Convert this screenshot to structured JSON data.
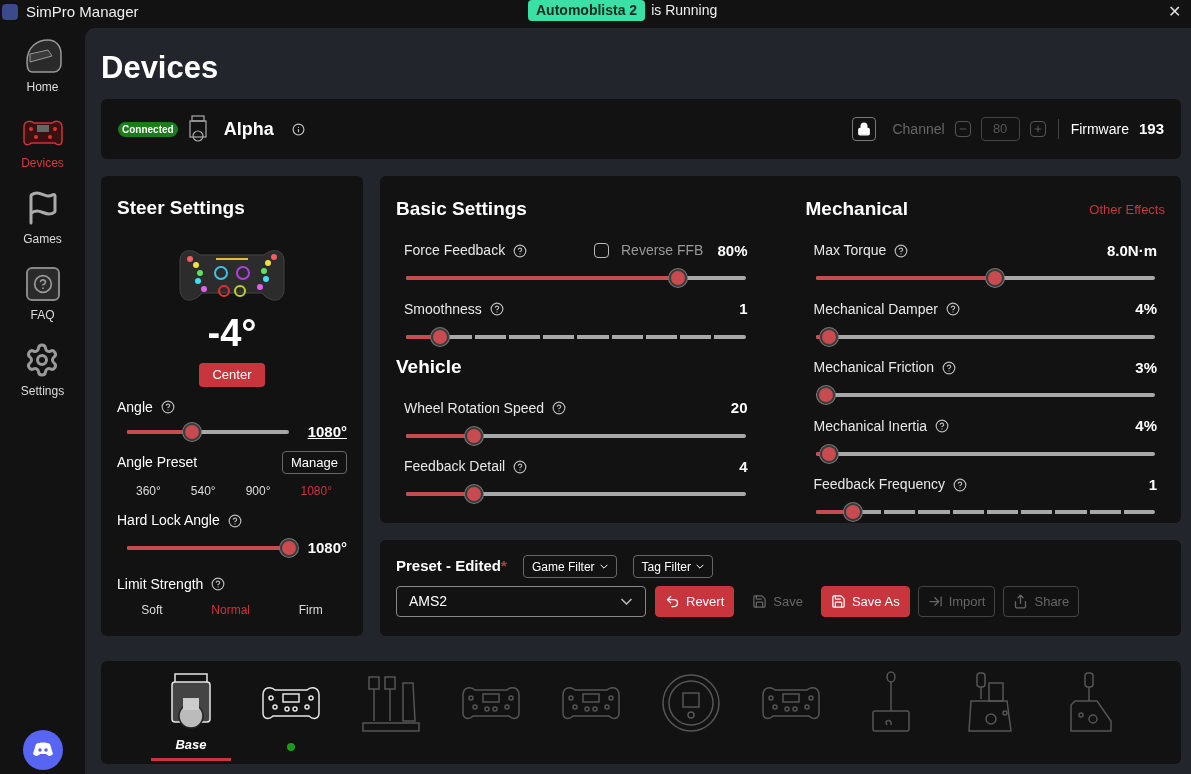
{
  "title_bar": {
    "app_name": "SimPro Manager",
    "game": "Automoblista 2",
    "status": "is Running",
    "close": "✕"
  },
  "sidebar": {
    "items": [
      {
        "kind": "home",
        "label": "Home",
        "selected": false
      },
      {
        "kind": "devices",
        "label": "Devices",
        "selected": true
      },
      {
        "kind": "games",
        "label": "Games",
        "selected": false
      },
      {
        "kind": "faq",
        "label": "FAQ",
        "selected": false
      },
      {
        "kind": "settings",
        "label": "Settings",
        "selected": false
      }
    ]
  },
  "page_title": "Devices",
  "device_bar": {
    "status": "Connected",
    "name": "Alpha",
    "locked": true,
    "channel_label": "Channel",
    "channel_value": "80",
    "firmware_label": "Firmware",
    "firmware_version": "193"
  },
  "steer": {
    "title": "Steer Settings",
    "angle_reading": "-4°",
    "center_button": "Center",
    "angle": {
      "label": "Angle",
      "level": 0.4,
      "reading": "1080°"
    },
    "preset_label": "Angle Preset",
    "manage_button": "Manage",
    "presets": [
      {
        "label": "360°",
        "selected": false
      },
      {
        "label": "540°",
        "selected": false
      },
      {
        "label": "900°",
        "selected": false
      },
      {
        "label": "1080°",
        "selected": true
      }
    ],
    "hard_lock": {
      "label": "Hard Lock Angle",
      "level": 1,
      "reading": "1080°"
    },
    "limit_label": "Limit Strength",
    "limits": [
      {
        "label": "Soft",
        "selected": false
      },
      {
        "label": "Normal",
        "selected": true
      },
      {
        "label": "Firm",
        "selected": false
      }
    ]
  },
  "basic": {
    "title": "Basic Settings",
    "reverse_ffb": {
      "label": "Reverse FFB",
      "checked": false
    },
    "sliders": [
      {
        "kind": "plain",
        "label": "Force Feedback",
        "level": 0.8,
        "reading": "80%"
      },
      {
        "kind": "stepped",
        "label": "Smoothness",
        "level": 0.1,
        "reading": "1"
      }
    ]
  },
  "vehicle": {
    "title": "Vehicle",
    "sliders": [
      {
        "kind": "plain",
        "label": "Wheel Rotation Speed",
        "level": 0.2,
        "reading": "20"
      },
      {
        "kind": "plain",
        "label": "Feedback Detail",
        "level": 0.2,
        "reading": "4"
      }
    ]
  },
  "mechanical": {
    "title": "Mechanical",
    "link": "Other Effects",
    "sliders": [
      {
        "kind": "plain",
        "label": "Max Torque",
        "level": 0.53,
        "reading": "8.0N·m"
      },
      {
        "kind": "plain",
        "label": "Mechanical Damper",
        "level": 0.04,
        "reading": "4%"
      },
      {
        "kind": "plain",
        "label": "Mechanical Friction",
        "level": 0.03,
        "reading": "3%"
      },
      {
        "kind": "plain",
        "label": "Mechanical Inertia",
        "level": 0.04,
        "reading": "4%"
      },
      {
        "kind": "stepped",
        "label": "Feedback Frequency",
        "level": 0.11,
        "reading": "1"
      }
    ]
  },
  "preset": {
    "title": "Preset - Edited",
    "edited_mark": "*",
    "game_filter": "Game Filter",
    "tag_filter": "Tag Filter",
    "value": "AMS2",
    "buttons": [
      {
        "kind": "revert",
        "label": "Revert",
        "disabled": false
      },
      {
        "kind": "save",
        "label": "Save",
        "disabled": true
      },
      {
        "kind": "save_as",
        "label": "Save As",
        "disabled": false
      },
      {
        "kind": "import",
        "label": "Import",
        "disabled": true
      },
      {
        "kind": "share",
        "label": "Share",
        "disabled": true
      }
    ]
  },
  "device_strip": {
    "items": [
      {
        "kind": "base",
        "label": "Base",
        "selected": true,
        "available": true,
        "connected": false
      },
      {
        "kind": "wheel",
        "selected": false,
        "available": true,
        "connected": true
      },
      {
        "kind": "pedals",
        "selected": false,
        "available": false,
        "connected": false
      },
      {
        "kind": "wheel",
        "selected": false,
        "available": false,
        "connected": false
      },
      {
        "kind": "wheel",
        "selected": false,
        "available": false,
        "connected": false
      },
      {
        "kind": "round_wheel",
        "selected": false,
        "available": false,
        "connected": false
      },
      {
        "kind": "wheel",
        "selected": false,
        "available": false,
        "connected": false
      },
      {
        "kind": "shifter",
        "selected": false,
        "available": false,
        "connected": false
      },
      {
        "kind": "sequential",
        "selected": false,
        "available": false,
        "connected": false
      },
      {
        "kind": "handbrake",
        "selected": false,
        "available": false,
        "connected": false
      }
    ]
  }
}
